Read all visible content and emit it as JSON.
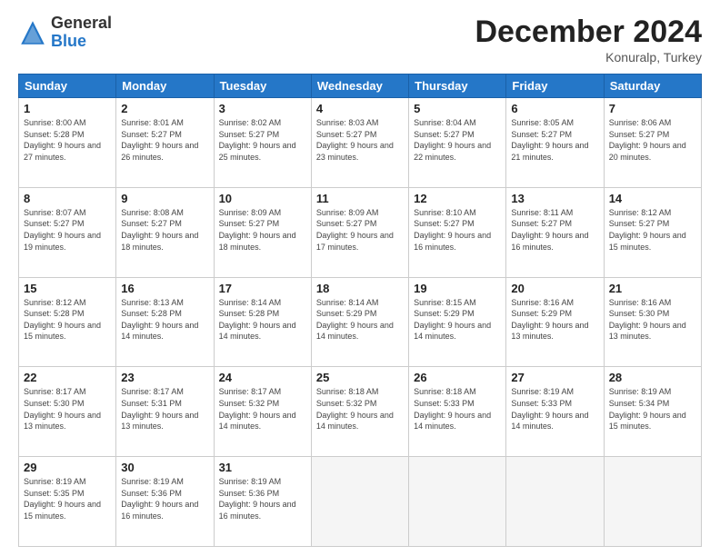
{
  "header": {
    "logo": {
      "general": "General",
      "blue": "Blue"
    },
    "title": "December 2024",
    "location": "Konuralp, Turkey"
  },
  "days_of_week": [
    "Sunday",
    "Monday",
    "Tuesday",
    "Wednesday",
    "Thursday",
    "Friday",
    "Saturday"
  ],
  "weeks": [
    [
      {
        "day": "1",
        "sunrise": "8:00 AM",
        "sunset": "5:28 PM",
        "daylight": "9 hours and 27 minutes."
      },
      {
        "day": "2",
        "sunrise": "8:01 AM",
        "sunset": "5:27 PM",
        "daylight": "9 hours and 26 minutes."
      },
      {
        "day": "3",
        "sunrise": "8:02 AM",
        "sunset": "5:27 PM",
        "daylight": "9 hours and 25 minutes."
      },
      {
        "day": "4",
        "sunrise": "8:03 AM",
        "sunset": "5:27 PM",
        "daylight": "9 hours and 23 minutes."
      },
      {
        "day": "5",
        "sunrise": "8:04 AM",
        "sunset": "5:27 PM",
        "daylight": "9 hours and 22 minutes."
      },
      {
        "day": "6",
        "sunrise": "8:05 AM",
        "sunset": "5:27 PM",
        "daylight": "9 hours and 21 minutes."
      },
      {
        "day": "7",
        "sunrise": "8:06 AM",
        "sunset": "5:27 PM",
        "daylight": "9 hours and 20 minutes."
      }
    ],
    [
      {
        "day": "8",
        "sunrise": "8:07 AM",
        "sunset": "5:27 PM",
        "daylight": "9 hours and 19 minutes."
      },
      {
        "day": "9",
        "sunrise": "8:08 AM",
        "sunset": "5:27 PM",
        "daylight": "9 hours and 18 minutes."
      },
      {
        "day": "10",
        "sunrise": "8:09 AM",
        "sunset": "5:27 PM",
        "daylight": "9 hours and 18 minutes."
      },
      {
        "day": "11",
        "sunrise": "8:09 AM",
        "sunset": "5:27 PM",
        "daylight": "9 hours and 17 minutes."
      },
      {
        "day": "12",
        "sunrise": "8:10 AM",
        "sunset": "5:27 PM",
        "daylight": "9 hours and 16 minutes."
      },
      {
        "day": "13",
        "sunrise": "8:11 AM",
        "sunset": "5:27 PM",
        "daylight": "9 hours and 16 minutes."
      },
      {
        "day": "14",
        "sunrise": "8:12 AM",
        "sunset": "5:27 PM",
        "daylight": "9 hours and 15 minutes."
      }
    ],
    [
      {
        "day": "15",
        "sunrise": "8:12 AM",
        "sunset": "5:28 PM",
        "daylight": "9 hours and 15 minutes."
      },
      {
        "day": "16",
        "sunrise": "8:13 AM",
        "sunset": "5:28 PM",
        "daylight": "9 hours and 14 minutes."
      },
      {
        "day": "17",
        "sunrise": "8:14 AM",
        "sunset": "5:28 PM",
        "daylight": "9 hours and 14 minutes."
      },
      {
        "day": "18",
        "sunrise": "8:14 AM",
        "sunset": "5:29 PM",
        "daylight": "9 hours and 14 minutes."
      },
      {
        "day": "19",
        "sunrise": "8:15 AM",
        "sunset": "5:29 PM",
        "daylight": "9 hours and 14 minutes."
      },
      {
        "day": "20",
        "sunrise": "8:16 AM",
        "sunset": "5:29 PM",
        "daylight": "9 hours and 13 minutes."
      },
      {
        "day": "21",
        "sunrise": "8:16 AM",
        "sunset": "5:30 PM",
        "daylight": "9 hours and 13 minutes."
      }
    ],
    [
      {
        "day": "22",
        "sunrise": "8:17 AM",
        "sunset": "5:30 PM",
        "daylight": "9 hours and 13 minutes."
      },
      {
        "day": "23",
        "sunrise": "8:17 AM",
        "sunset": "5:31 PM",
        "daylight": "9 hours and 13 minutes."
      },
      {
        "day": "24",
        "sunrise": "8:17 AM",
        "sunset": "5:32 PM",
        "daylight": "9 hours and 14 minutes."
      },
      {
        "day": "25",
        "sunrise": "8:18 AM",
        "sunset": "5:32 PM",
        "daylight": "9 hours and 14 minutes."
      },
      {
        "day": "26",
        "sunrise": "8:18 AM",
        "sunset": "5:33 PM",
        "daylight": "9 hours and 14 minutes."
      },
      {
        "day": "27",
        "sunrise": "8:19 AM",
        "sunset": "5:33 PM",
        "daylight": "9 hours and 14 minutes."
      },
      {
        "day": "28",
        "sunrise": "8:19 AM",
        "sunset": "5:34 PM",
        "daylight": "9 hours and 15 minutes."
      }
    ],
    [
      {
        "day": "29",
        "sunrise": "8:19 AM",
        "sunset": "5:35 PM",
        "daylight": "9 hours and 15 minutes."
      },
      {
        "day": "30",
        "sunrise": "8:19 AM",
        "sunset": "5:36 PM",
        "daylight": "9 hours and 16 minutes."
      },
      {
        "day": "31",
        "sunrise": "8:19 AM",
        "sunset": "5:36 PM",
        "daylight": "9 hours and 16 minutes."
      },
      null,
      null,
      null,
      null
    ]
  ]
}
